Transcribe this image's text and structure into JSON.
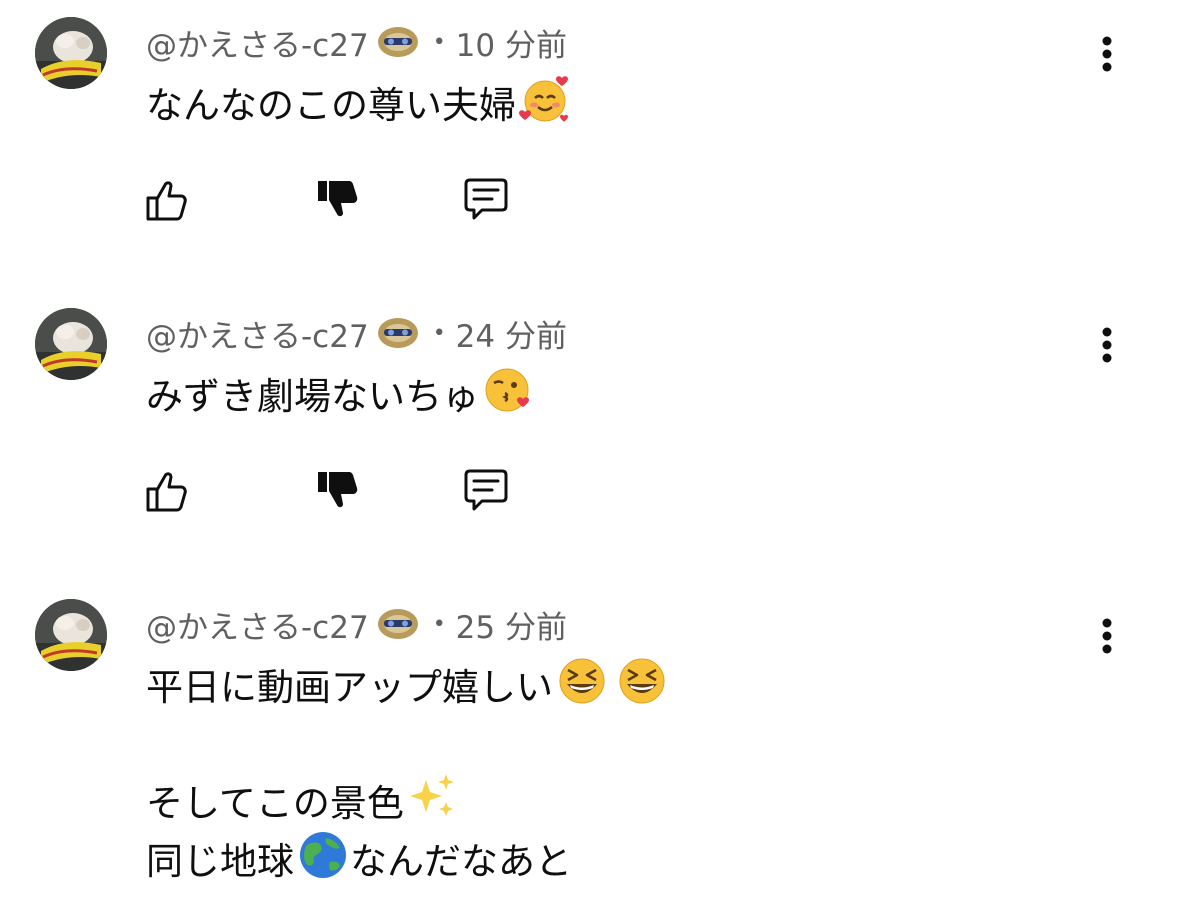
{
  "comments": [
    {
      "handle": "@かえさる-c27",
      "separator": "•",
      "time": "10 分前",
      "text_lines": [
        "なんなのこの尊い夫婦"
      ],
      "emojis": [
        "smiling-face-with-hearts"
      ]
    },
    {
      "handle": "@かえさる-c27",
      "separator": "•",
      "time": "24 分前",
      "text_lines": [
        "みずき劇場ないちゅ"
      ],
      "emojis": [
        "face-blowing-kiss"
      ]
    },
    {
      "handle": "@かえさる-c27",
      "separator": "•",
      "time": "25 分前",
      "text_lines": [
        "平日に動画アップ嬉しい",
        "",
        "そしてこの景色",
        "同じ地球",
        "なんだなあと"
      ],
      "emojis": [
        "grinning-squinting-face",
        "grinning-squinting-face",
        "sparkles",
        "globe-asia-australia"
      ]
    }
  ],
  "icons": {
    "like": "thumbs-up-outline-icon",
    "dislike": "thumbs-down-filled-icon",
    "reply": "comment-reply-icon",
    "more": "vertical-ellipsis-icon"
  },
  "colors": {
    "text": "#0f0f0f",
    "meta": "#606060",
    "background": "#ffffff"
  }
}
